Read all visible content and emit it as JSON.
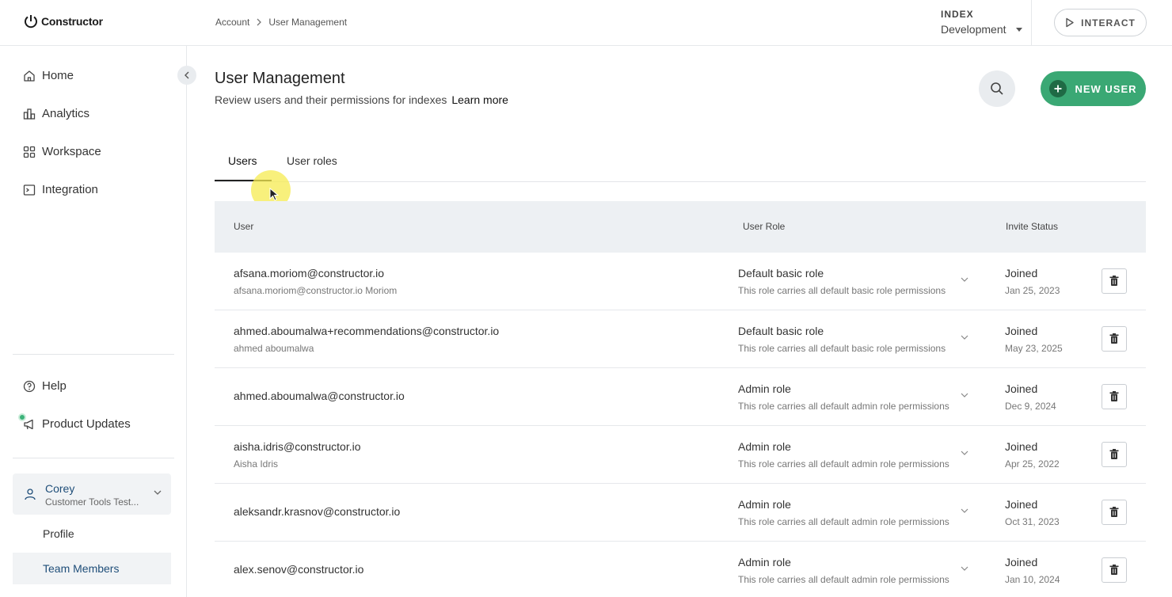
{
  "header": {
    "logo_text": "Constructor",
    "breadcrumb": [
      "Account",
      "User Management"
    ],
    "index_label": "INDEX",
    "index_value": "Development",
    "interact_label": "INTERACT"
  },
  "sidebar": {
    "nav": [
      {
        "label": "Home",
        "icon": "home-icon"
      },
      {
        "label": "Analytics",
        "icon": "analytics-icon"
      },
      {
        "label": "Workspace",
        "icon": "workspace-icon"
      },
      {
        "label": "Integration",
        "icon": "integration-icon"
      }
    ],
    "help_label": "Help",
    "updates_label": "Product Updates",
    "user": {
      "name": "Corey",
      "org": "Customer Tools Test..."
    },
    "sub_items": [
      {
        "label": "Profile",
        "active": false
      },
      {
        "label": "Team Members",
        "active": true
      }
    ]
  },
  "main": {
    "title": "User Management",
    "subtitle": "Review users and their permissions for indexes",
    "learn_more": "Learn more",
    "new_user_label": "NEW USER",
    "tabs": [
      {
        "label": "Users",
        "active": true
      },
      {
        "label": "User roles",
        "active": false
      }
    ],
    "table": {
      "headers": [
        "User",
        "User Role",
        "Invite Status"
      ],
      "rows": [
        {
          "email": "afsana.moriom@constructor.io",
          "name": "afsana.moriom@constructor.io Moriom",
          "role": "Default basic role",
          "role_desc": "This role carries all default basic role permissions",
          "status": "Joined",
          "date": "Jan 25, 2023"
        },
        {
          "email": "ahmed.aboumalwa+recommendations@constructor.io",
          "name": "ahmed aboumalwa",
          "role": "Default basic role",
          "role_desc": "This role carries all default basic role permissions",
          "status": "Joined",
          "date": "May 23, 2025"
        },
        {
          "email": "ahmed.aboumalwa@constructor.io",
          "name": "",
          "role": "Admin role",
          "role_desc": "This role carries all default admin role permissions",
          "status": "Joined",
          "date": "Dec 9, 2024"
        },
        {
          "email": "aisha.idris@constructor.io",
          "name": "Aisha Idris",
          "role": "Admin role",
          "role_desc": "This role carries all default admin role permissions",
          "status": "Joined",
          "date": "Apr 25, 2022"
        },
        {
          "email": "aleksandr.krasnov@constructor.io",
          "name": "",
          "role": "Admin role",
          "role_desc": "This role carries all default admin role permissions",
          "status": "Joined",
          "date": "Oct 31, 2023"
        },
        {
          "email": "alex.senov@constructor.io",
          "name": "",
          "role": "Admin role",
          "role_desc": "This role carries all default admin role permissions",
          "status": "Joined",
          "date": "Jan 10, 2024"
        }
      ]
    }
  },
  "colors": {
    "accent": "#3aa874",
    "link": "#1f4e79",
    "notification_dot": "#3cb37a"
  }
}
